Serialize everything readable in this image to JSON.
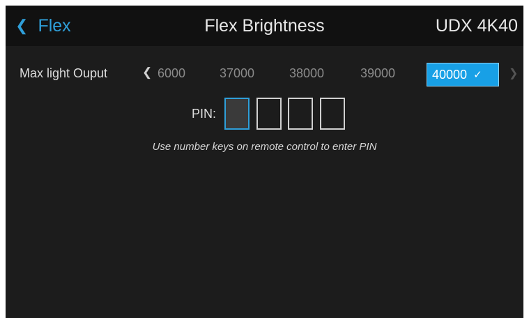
{
  "header": {
    "back_label": "Flex",
    "title": "Flex Brightness",
    "model": "UDX 4K40"
  },
  "light_output": {
    "label": "Max light Ouput",
    "options": [
      "6000",
      "37000",
      "38000",
      "39000",
      "40000"
    ],
    "selected": "40000"
  },
  "pin": {
    "label": "PIN:",
    "digits": 4,
    "hint": "Use number keys on remote control to enter PIN"
  },
  "colors": {
    "accent": "#18a0e6",
    "link": "#2f9fd9",
    "background": "#1c1c1c",
    "header_background": "#111111"
  }
}
